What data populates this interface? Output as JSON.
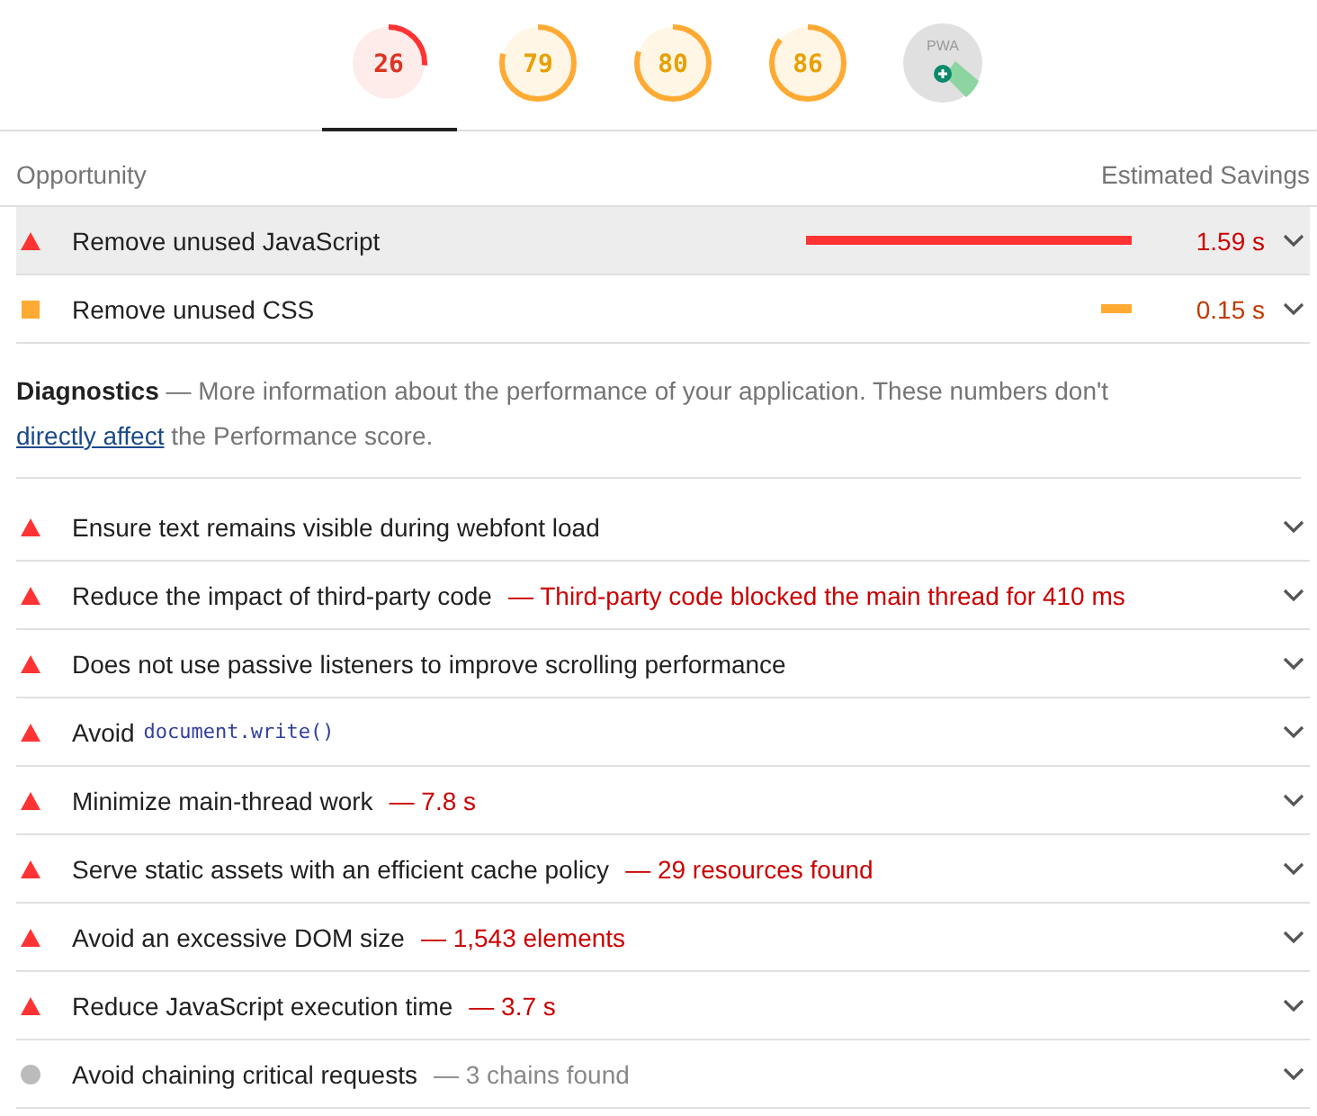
{
  "gauges": [
    {
      "kind": "fail",
      "score": "26",
      "selected": true
    },
    {
      "kind": "average",
      "score": "79",
      "selected": false
    },
    {
      "kind": "average",
      "score": "80",
      "selected": false
    },
    {
      "kind": "average",
      "score": "86",
      "selected": false
    },
    {
      "kind": "pwa",
      "score": "PWA",
      "selected": false
    }
  ],
  "opportunities": {
    "column_1": "Opportunity",
    "column_2": "Estimated Savings",
    "items": [
      {
        "kind": "fail",
        "title": "Remove unused JavaScript",
        "savings": "1.59 s",
        "selected": true
      },
      {
        "kind": "average",
        "title": "Remove unused CSS",
        "savings": "0.15 s",
        "selected": false
      }
    ]
  },
  "diagnostics": {
    "heading": "Diagnostics",
    "description": "— More information about the performance of your application. These numbers don't",
    "link": "directly affect",
    "description_end": "the Performance score.",
    "items": [
      {
        "kind": "fail",
        "title": "Ensure text remains visible during webfont load"
      },
      {
        "kind": "fail",
        "title": "Reduce the impact of third-party code",
        "detail": "— Third-party code blocked the main thread for 410 ms"
      },
      {
        "kind": "fail",
        "title": "Does not use passive listeners to improve scrolling performance"
      },
      {
        "kind": "fail",
        "title": "Avoid",
        "code": "document.write()"
      },
      {
        "kind": "fail",
        "title": "Minimize main-thread work",
        "detail": "— 7.8 s"
      },
      {
        "kind": "fail",
        "title": "Serve static assets with an efficient cache policy",
        "detail": "— 29 resources found"
      },
      {
        "kind": "fail",
        "title": "Avoid an excessive DOM size",
        "detail": "— 1,543 elements"
      },
      {
        "kind": "fail",
        "title": "Reduce JavaScript execution time",
        "detail": "— 3.7 s"
      },
      {
        "kind": "info",
        "title": "Avoid chaining critical requests",
        "detail": "— 3 chains found"
      }
    ]
  }
}
